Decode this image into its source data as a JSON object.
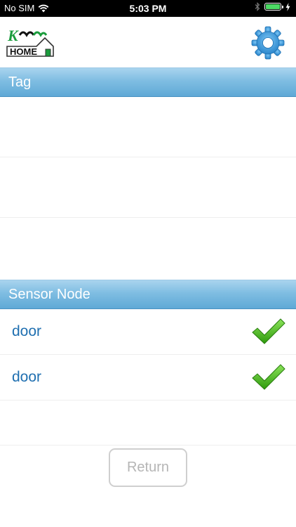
{
  "status_bar": {
    "carrier": "No SIM",
    "time": "5:03 PM",
    "battery_level": 1.0,
    "icons": [
      "wifi-icon",
      "bluetooth-icon",
      "battery-icon",
      "charging-icon"
    ]
  },
  "header": {
    "logo_text_top": "K",
    "logo_text_bottom": "HOME",
    "settings_icon": "gear-icon"
  },
  "sections": {
    "tag": {
      "title": "Tag"
    },
    "sensor": {
      "title": "Sensor Node"
    }
  },
  "sensors": [
    {
      "name": "door",
      "status_icon": "checkmark-icon"
    },
    {
      "name": "door",
      "status_icon": "checkmark-icon"
    }
  ],
  "footer": {
    "return_label": "Return"
  },
  "colors": {
    "section_header": "#6fb3de",
    "sensor_text": "#1f6fb0",
    "gear": "#3a98d8",
    "check": "#3cb80e",
    "battery": "#4cd964"
  }
}
